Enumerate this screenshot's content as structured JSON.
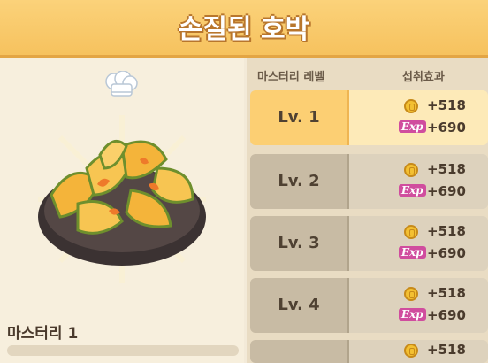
{
  "title": "손질된 호박",
  "mastery": {
    "label": "마스터리 1"
  },
  "table": {
    "headers": {
      "level": "마스터리 레벨",
      "effect": "섭취효과"
    },
    "rows": [
      {
        "level": "Lv. 1",
        "gold": "+518",
        "exp_badge": "Exp",
        "exp": "+690",
        "active": true
      },
      {
        "level": "Lv. 2",
        "gold": "+518",
        "exp_badge": "Exp",
        "exp": "+690",
        "active": false
      },
      {
        "level": "Lv. 3",
        "gold": "+518",
        "exp_badge": "Exp",
        "exp": "+690",
        "active": false
      },
      {
        "level": "Lv. 4",
        "gold": "+518",
        "exp_badge": "Exp",
        "exp": "+690",
        "active": false
      },
      {
        "level": "",
        "gold": "+518",
        "exp_badge": "",
        "exp": "",
        "active": false
      }
    ]
  },
  "icons": {
    "hat": "chef-hat-icon",
    "dish": "pumpkin-dish-image",
    "coin": "coin-icon"
  },
  "colors": {
    "title_bg": "#f6c25e",
    "active_row": "#fccf73",
    "exp_badge": "#d04d9e"
  }
}
